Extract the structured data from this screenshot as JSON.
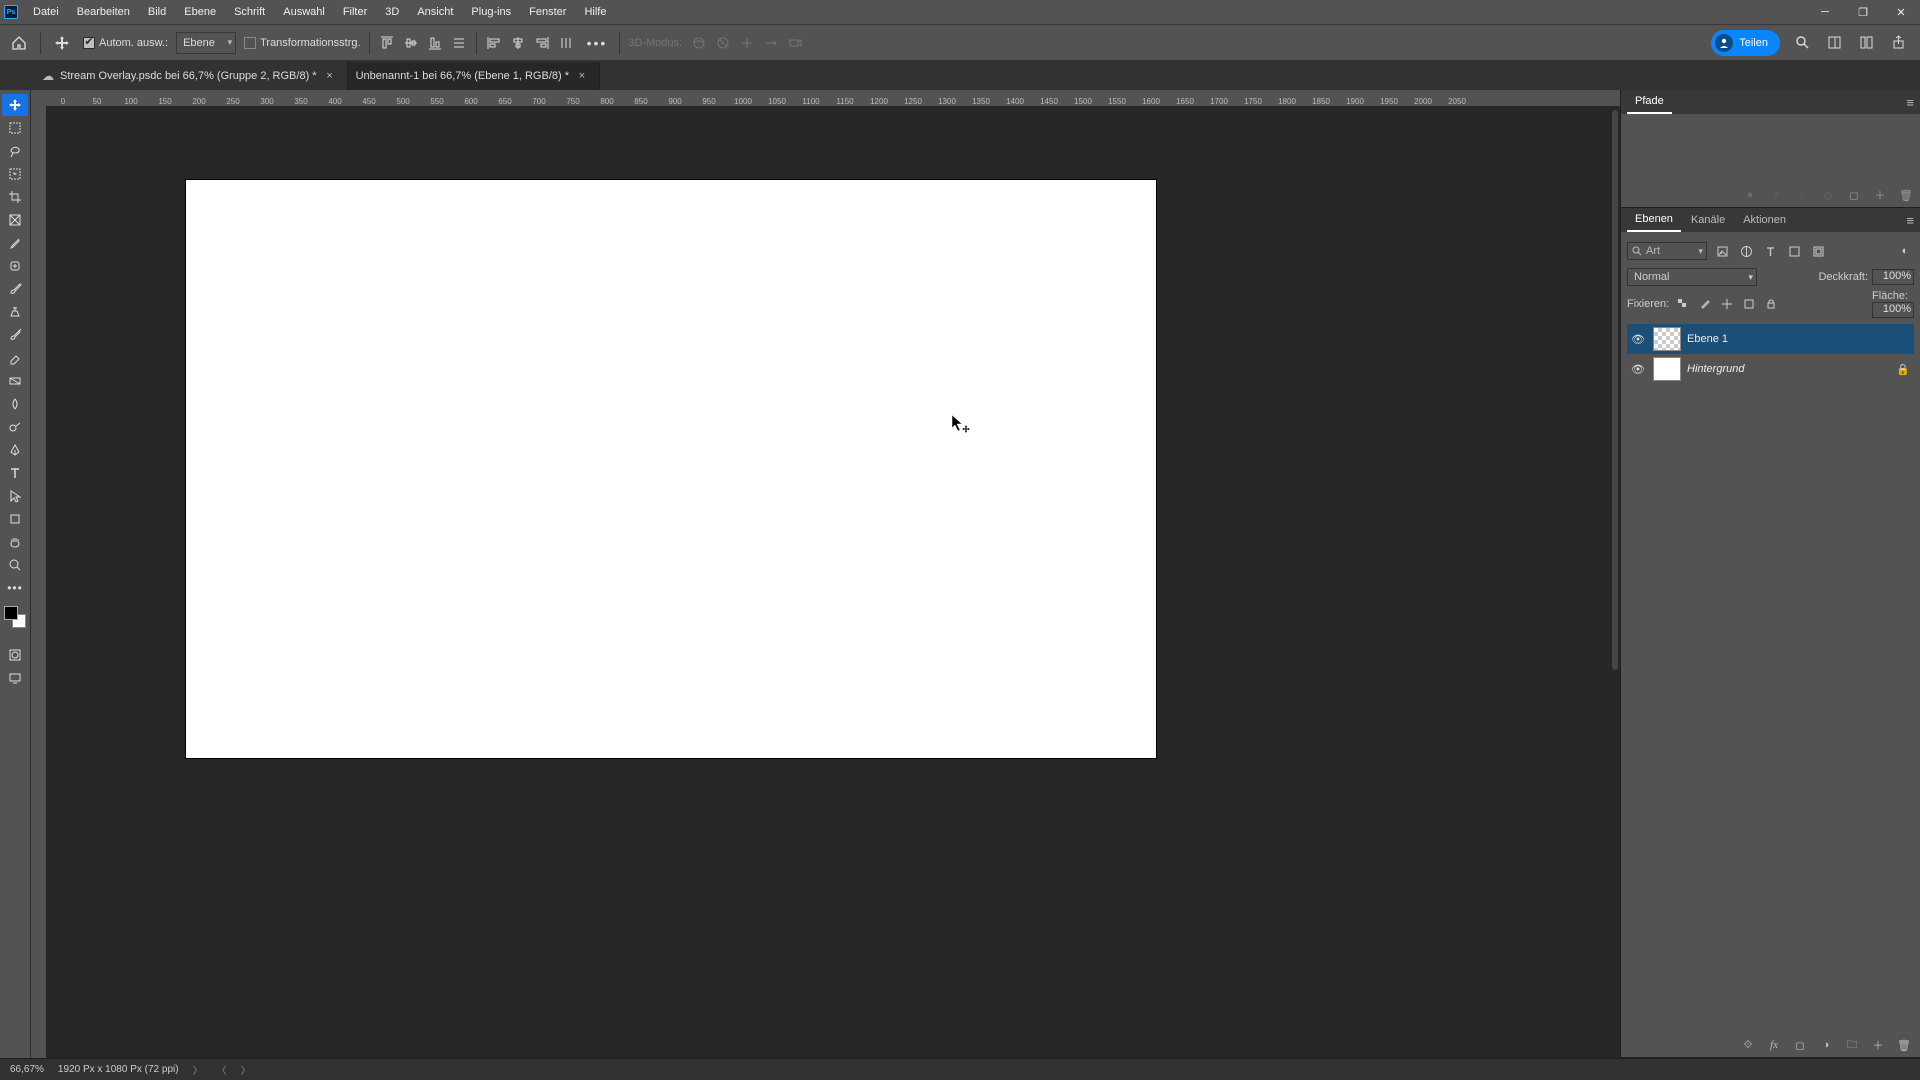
{
  "menubar": {
    "items": [
      "Datei",
      "Bearbeiten",
      "Bild",
      "Ebene",
      "Schrift",
      "Auswahl",
      "Filter",
      "3D",
      "Ansicht",
      "Plug-ins",
      "Fenster",
      "Hilfe"
    ]
  },
  "optionsbar": {
    "auto_select_label": "Autom. ausw.:",
    "auto_select_checked": true,
    "target_dropdown": "Ebene",
    "transform_label": "Transformationsstrg.",
    "transform_checked": false,
    "mode3d_label": "3D-Modus:",
    "share_label": "Teilen"
  },
  "tabs": [
    {
      "title": "Stream Overlay.psdc bei 66,7% (Gruppe 2, RGB/8)",
      "dirty": "*",
      "active": false,
      "cloud": true
    },
    {
      "title": "Unbenannt-1 bei 66,7% (Ebene 1, RGB/8)",
      "dirty": "*",
      "active": true,
      "cloud": false
    }
  ],
  "ruler_ticks": [
    "0",
    "50",
    "100",
    "150",
    "200",
    "250",
    "300",
    "350",
    "400",
    "450",
    "500",
    "550",
    "600",
    "650",
    "700",
    "750",
    "800",
    "850",
    "900",
    "950",
    "1000",
    "1050",
    "1100",
    "1150",
    "1200",
    "1250",
    "1300",
    "1350",
    "1400",
    "1450",
    "1500",
    "1550",
    "1600",
    "1650",
    "1700",
    "1750",
    "1800",
    "1850",
    "1900",
    "1950",
    "2000",
    "2050"
  ],
  "panels": {
    "paths_tab": "Pfade",
    "layers_tabs": [
      "Ebenen",
      "Kanäle",
      "Aktionen"
    ],
    "layers_tabs_active": 0,
    "search_label": "Art",
    "blend_mode": "Normal",
    "opacity_label": "Deckkraft:",
    "opacity_value": "100%",
    "lock_label": "Fixieren:",
    "fill_label": "Fläche:",
    "fill_value": "100%",
    "layers": [
      {
        "name": "Ebene 1",
        "italic": false,
        "locked": false,
        "checker": true,
        "selected": true
      },
      {
        "name": "Hintergrund",
        "italic": true,
        "locked": true,
        "checker": false,
        "selected": false
      }
    ]
  },
  "statusbar": {
    "zoom": "66,67%",
    "doc_info": "1920 Px x 1080 Px (72 ppi)"
  }
}
